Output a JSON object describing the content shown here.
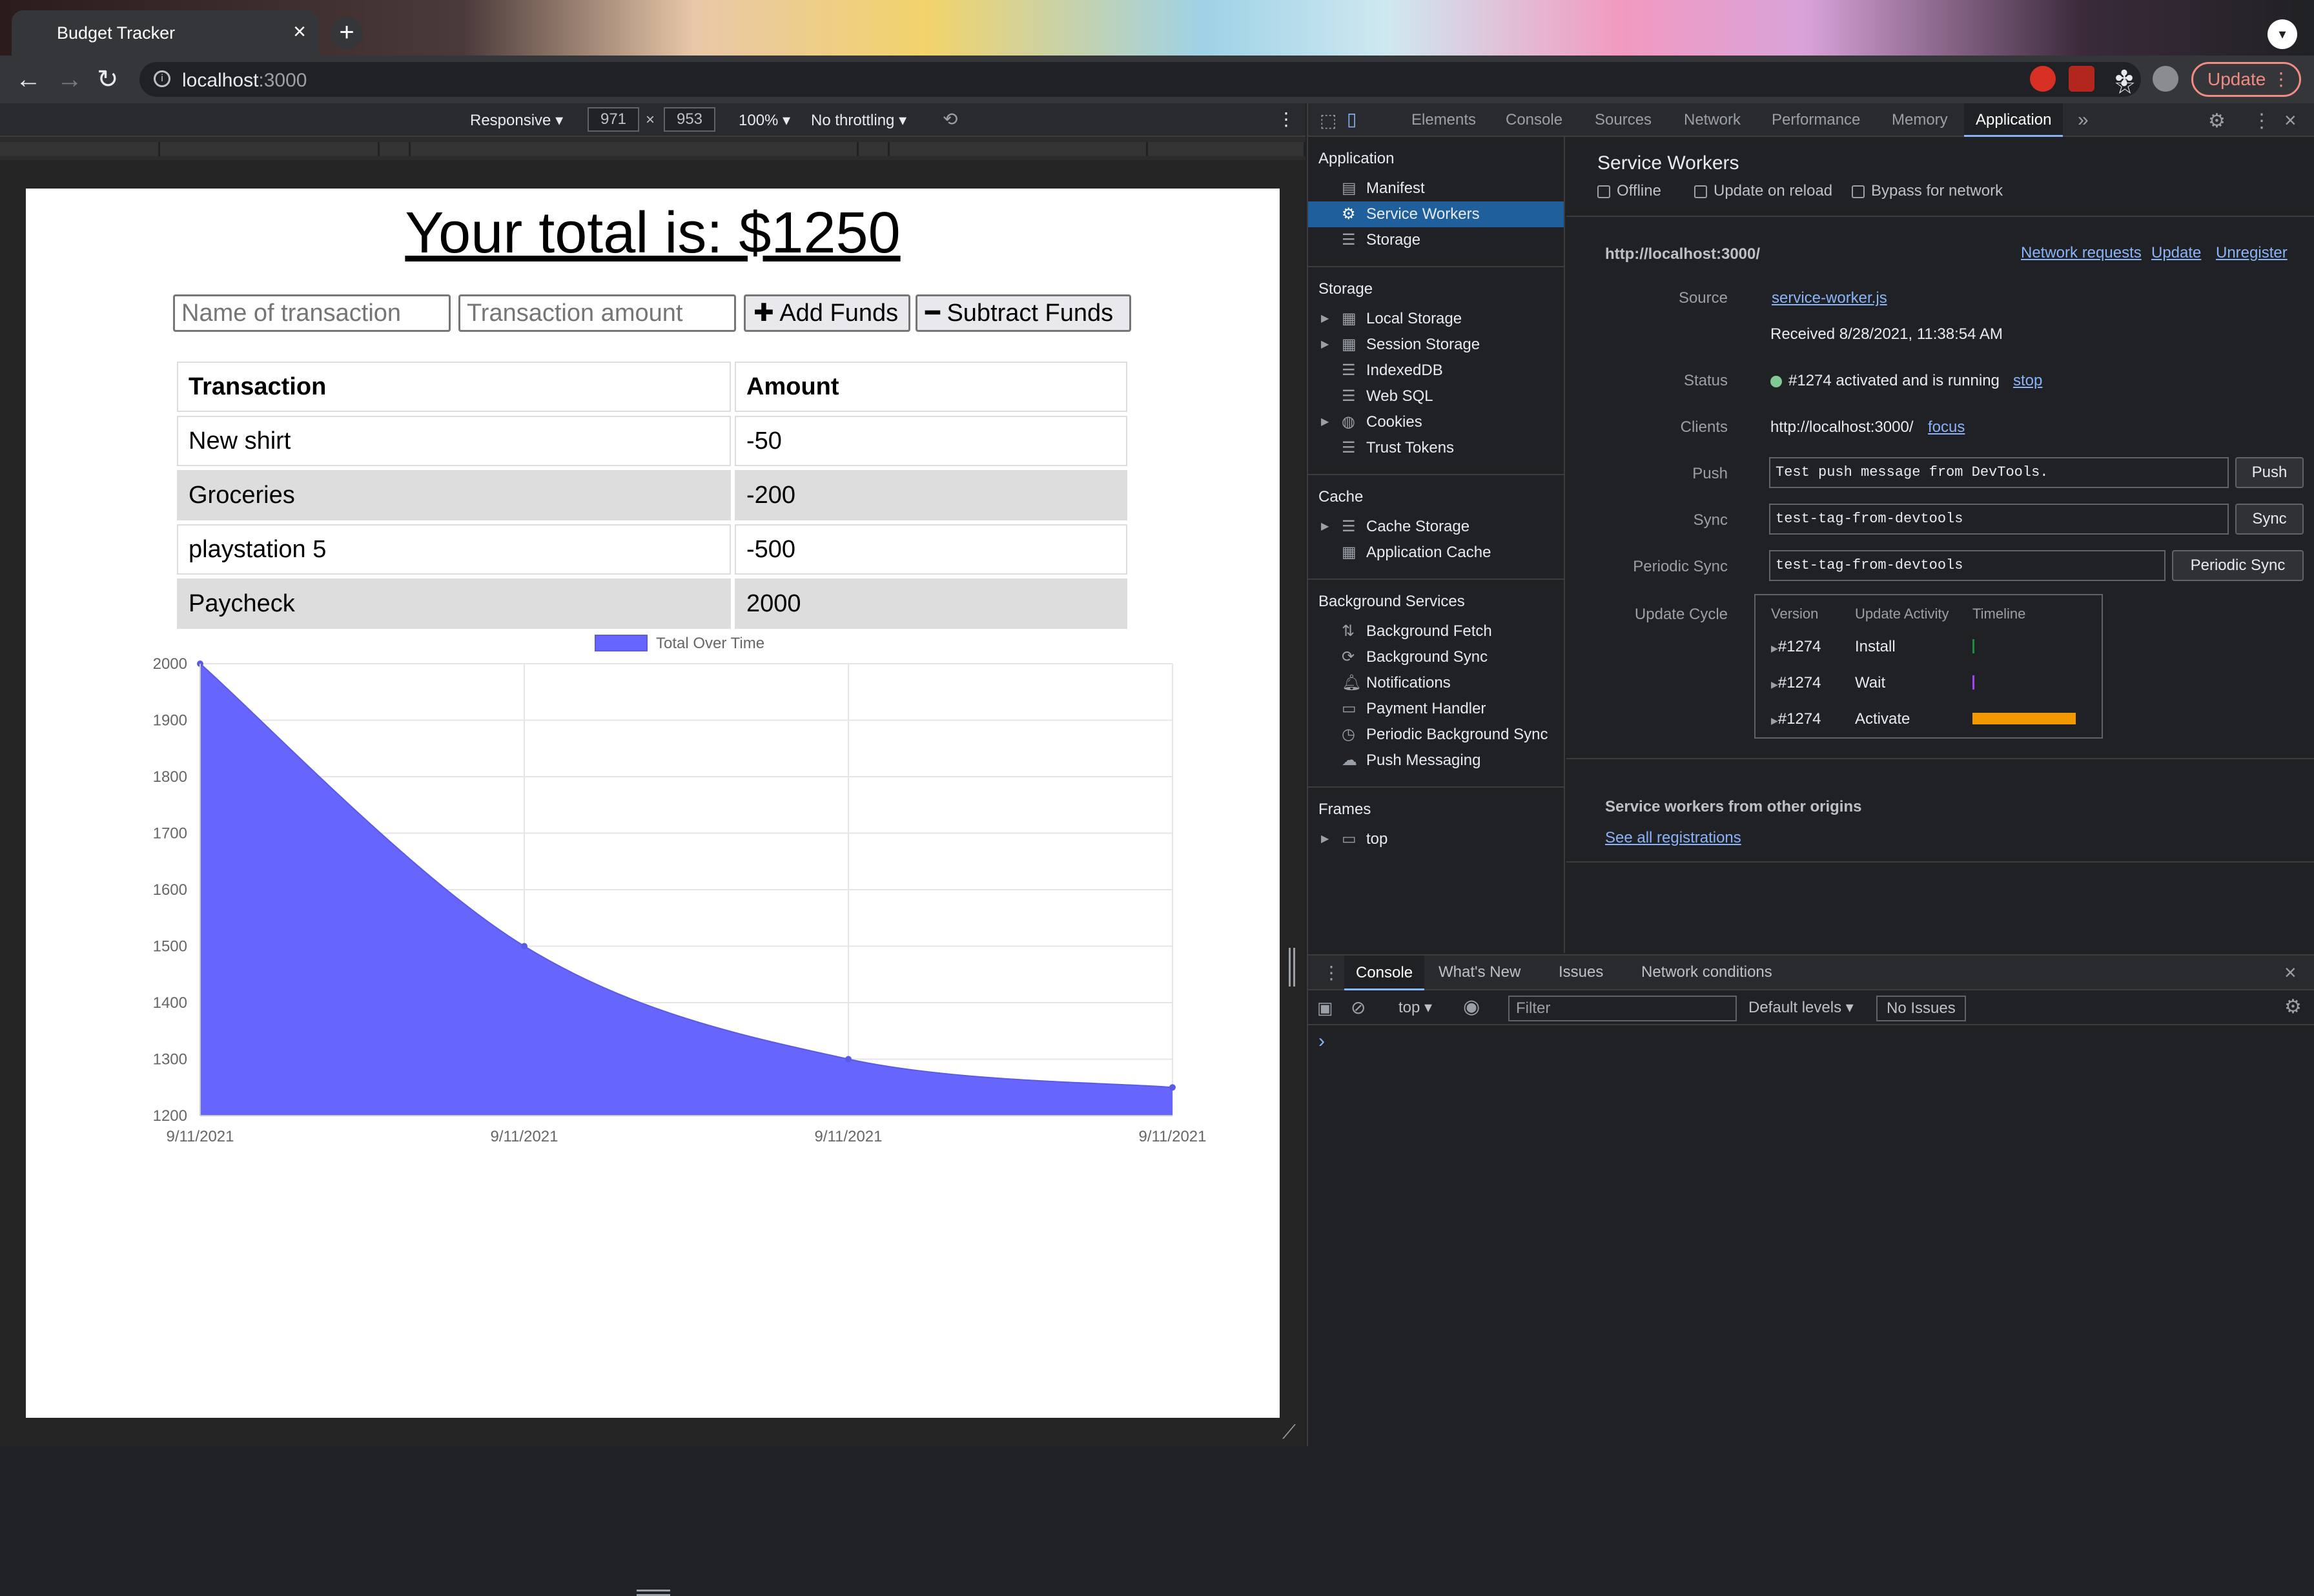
{
  "browser": {
    "tab_title": "Budget Tracker",
    "url_host": "localhost",
    "url_port": ":3000",
    "update_label": "Update"
  },
  "device_toolbar": {
    "mode": "Responsive",
    "width": "971",
    "height": "953",
    "zoom": "100%",
    "throttling": "No throttling",
    "times": "×"
  },
  "app": {
    "total_title": "Your total is: $1250",
    "name_placeholder": "Name of transaction",
    "amount_placeholder": "Transaction amount",
    "add_label": "Add Funds",
    "subtract_label": "Subtract Funds",
    "columns": [
      "Transaction",
      "Amount"
    ],
    "rows": [
      {
        "name": "New shirt",
        "amount": "-50"
      },
      {
        "name": "Groceries",
        "amount": "-200"
      },
      {
        "name": "playstation 5",
        "amount": "-500"
      },
      {
        "name": "Paycheck",
        "amount": "2000"
      }
    ]
  },
  "chart_data": {
    "type": "area",
    "x": [
      "9/11/2021",
      "9/11/2021",
      "9/11/2021",
      "9/11/2021"
    ],
    "series": [
      {
        "name": "Total Over Time",
        "values": [
          2000,
          1500,
          1300,
          1250
        ],
        "color": "#6666ff"
      }
    ],
    "y_ticks": [
      2000,
      1900,
      1800,
      1700,
      1600,
      1500,
      1400,
      1300,
      1200
    ],
    "ylim": [
      1200,
      2000
    ],
    "grid": true,
    "legend": "top-center"
  },
  "devtools": {
    "tabs": [
      "Elements",
      "Console",
      "Sources",
      "Network",
      "Performance",
      "Memory",
      "Application"
    ],
    "more": "»",
    "sidebar": {
      "application_head": "Application",
      "application_items": [
        "Manifest",
        "Service Workers",
        "Storage"
      ],
      "storage_head": "Storage",
      "storage_items": [
        "Local Storage",
        "Session Storage",
        "IndexedDB",
        "Web SQL",
        "Cookies",
        "Trust Tokens"
      ],
      "cache_head": "Cache",
      "cache_items": [
        "Cache Storage",
        "Application Cache"
      ],
      "bg_head": "Background Services",
      "bg_items": [
        "Background Fetch",
        "Background Sync",
        "Notifications",
        "Payment Handler",
        "Periodic Background Sync",
        "Push Messaging"
      ],
      "frames_head": "Frames",
      "frames_items": [
        "top"
      ]
    },
    "sw": {
      "title": "Service Workers",
      "offline": "Offline",
      "update_on_reload": "Update on reload",
      "bypass": "Bypass for network",
      "origin": "http://localhost:3000/",
      "network_requests": "Network requests",
      "update": "Update",
      "unregister": "Unregister",
      "source_label": "Source",
      "source_file": "service-worker.js",
      "received": "Received 8/28/2021, 11:38:54 AM",
      "status_label": "Status",
      "status_text": "#1274 activated and is running",
      "stop": "stop",
      "clients_label": "Clients",
      "clients_url": "http://localhost:3000/",
      "focus": "focus",
      "push_label": "Push",
      "push_value": "Test push message from DevTools.",
      "push_btn": "Push",
      "sync_label": "Sync",
      "sync_value": "test-tag-from-devtools",
      "sync_btn": "Sync",
      "psync_label": "Periodic Sync",
      "psync_value": "test-tag-from-devtools",
      "psync_btn": "Periodic Sync",
      "cycle_label": "Update Cycle",
      "cycle_cols": [
        "Version",
        "Update Activity",
        "Timeline"
      ],
      "cycle_rows": [
        {
          "version": "#1274",
          "activity": "Install"
        },
        {
          "version": "#1274",
          "activity": "Wait"
        },
        {
          "version": "#1274",
          "activity": "Activate"
        }
      ],
      "other_origins": "Service workers from other origins",
      "see_all": "See all registrations"
    },
    "drawer": {
      "tabs": [
        "Console",
        "What's New",
        "Issues",
        "Network conditions"
      ],
      "context": "top",
      "filter_placeholder": "Filter",
      "levels": "Default levels",
      "issues": "No Issues",
      "prompt": "›"
    }
  }
}
